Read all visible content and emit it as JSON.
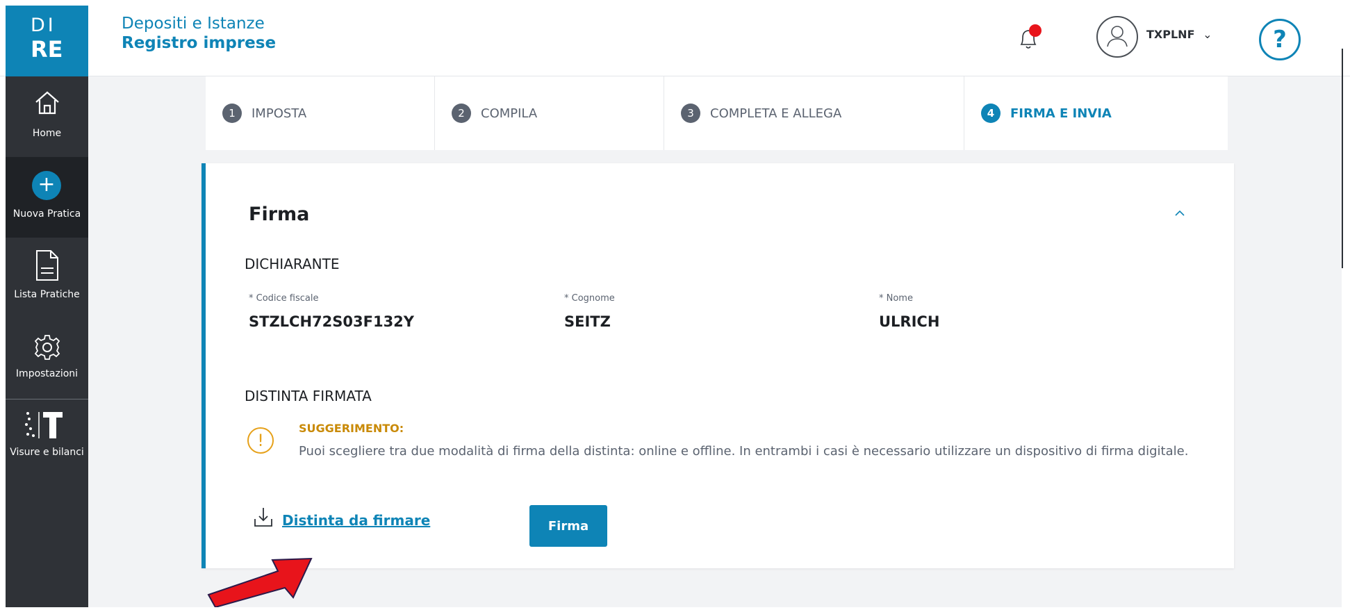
{
  "logo": {
    "line1": "DI",
    "line2": "RE"
  },
  "header": {
    "title_line1": "Depositi e Istanze",
    "title_line2": "Registro imprese",
    "username": "TXPLNF",
    "help_label": "?"
  },
  "sidebar": {
    "items": [
      {
        "label": "Home",
        "icon": "home-icon"
      },
      {
        "label": "Nuova Pratica",
        "icon": "plus-icon"
      },
      {
        "label": "Lista Pratiche",
        "icon": "document-icon"
      },
      {
        "label": "Impostazioni",
        "icon": "gear-icon"
      },
      {
        "label": "Visure e bilanci",
        "icon": "it-logo-icon"
      }
    ]
  },
  "stepper": {
    "steps": [
      {
        "num": "1",
        "label": "IMPOSTA"
      },
      {
        "num": "2",
        "label": "COMPILA"
      },
      {
        "num": "3",
        "label": "COMPLETA E ALLEGA"
      },
      {
        "num": "4",
        "label": "FIRMA E INVIA"
      }
    ],
    "active_step": 4
  },
  "card": {
    "title": "Firma",
    "dichiarante": {
      "heading": "DICHIARANTE",
      "fields": [
        {
          "label": "* Codice fiscale",
          "value": "STZLCH72S03F132Y"
        },
        {
          "label": "* Cognome",
          "value": "SEITZ"
        },
        {
          "label": "* Nome",
          "value": "ULRICH"
        }
      ]
    },
    "distinta": {
      "heading": "DISTINTA FIRMATA",
      "tip_title": "SUGGERIMENTO:",
      "tip_text": "Puoi scegliere tra due modalità di firma della distinta: online e offline. In entrambi i casi è necessario utilizzare un dispositivo di firma digitale.",
      "download_link": "Distinta da firmare",
      "sign_button": "Firma"
    }
  },
  "colors": {
    "accent": "#0e84b6",
    "sidebar": "#2f3237",
    "warning": "#e6a11a",
    "annotation_arrow": "#e8141b"
  }
}
